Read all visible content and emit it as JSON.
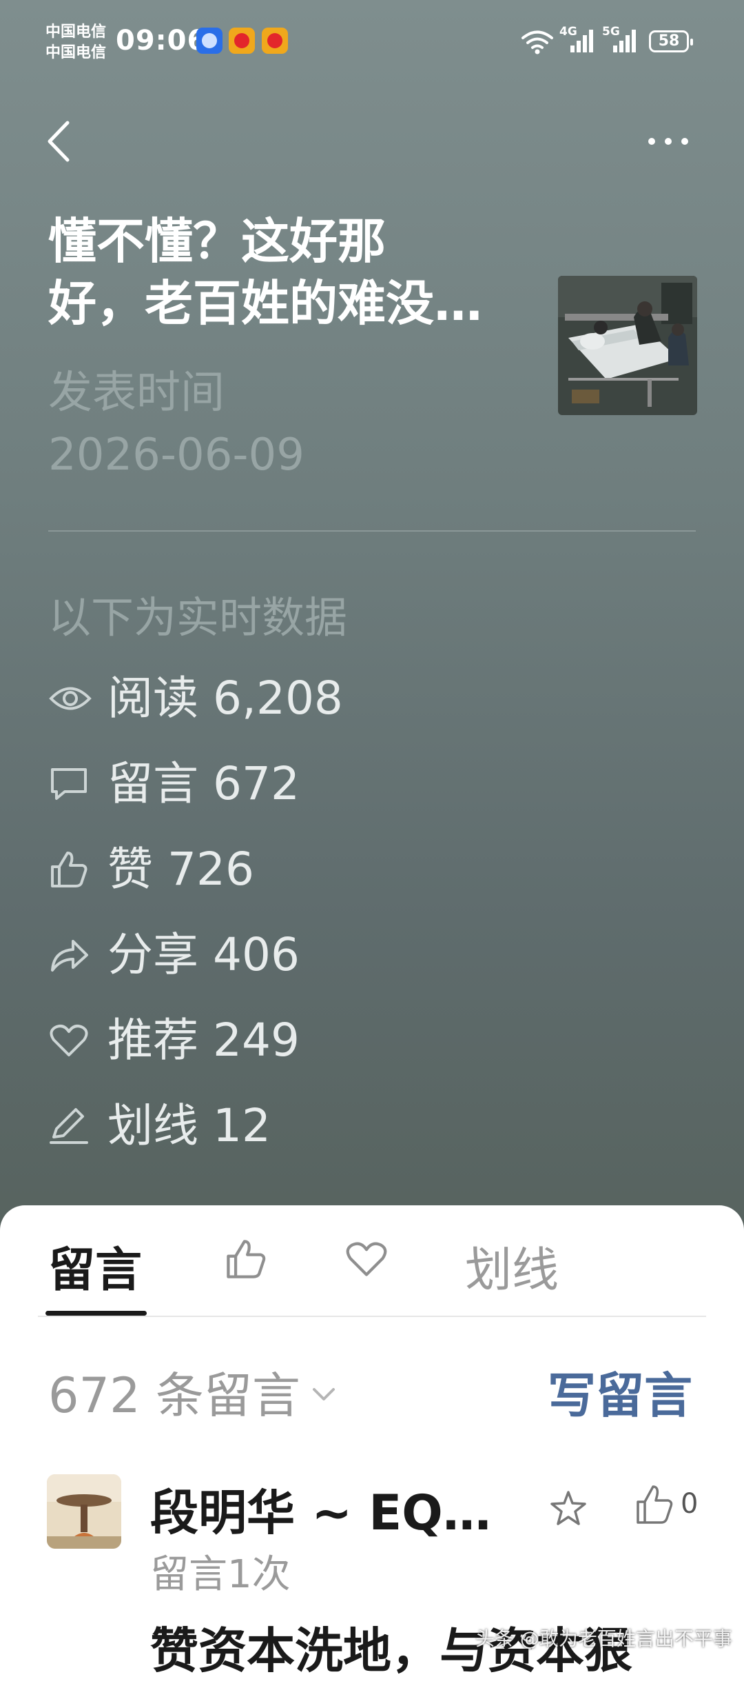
{
  "status_bar": {
    "carrier_1": "中国电信",
    "carrier_2": "中国电信",
    "time": "09:06",
    "net_1": "4G",
    "net_2": "5G",
    "battery": "58"
  },
  "article": {
    "title_line_1": "懂不懂？这好那",
    "title_line_2": "好，老百姓的难没…",
    "published_label": "发表时间",
    "published_date": "2026-06-09"
  },
  "stats": {
    "heading": "以下为实时数据",
    "items": [
      {
        "icon": "eye-icon",
        "label": "阅读 6,208"
      },
      {
        "icon": "comment-icon",
        "label": "留言 672"
      },
      {
        "icon": "thumbs-up-icon",
        "label": "赞 726"
      },
      {
        "icon": "share-icon",
        "label": "分享 406"
      },
      {
        "icon": "heart-icon",
        "label": "推荐 249"
      },
      {
        "icon": "pen-icon",
        "label": "划线 12"
      }
    ]
  },
  "sheet": {
    "tabs": {
      "comments": "留言",
      "highlights": "划线"
    },
    "count_text": "672 条留言",
    "write_label": "写留言"
  },
  "comment": {
    "author": "段明华 ~ EQ…",
    "meta": "留言1次",
    "text": "赞资本洗地，与资本狠",
    "likes": "0"
  },
  "watermark": "头条 @敢为老百姓言出不平事",
  "colors": {
    "header_bg": "#738282",
    "accent_link": "#4a6a9a",
    "muted_text": "#98a5a5"
  }
}
